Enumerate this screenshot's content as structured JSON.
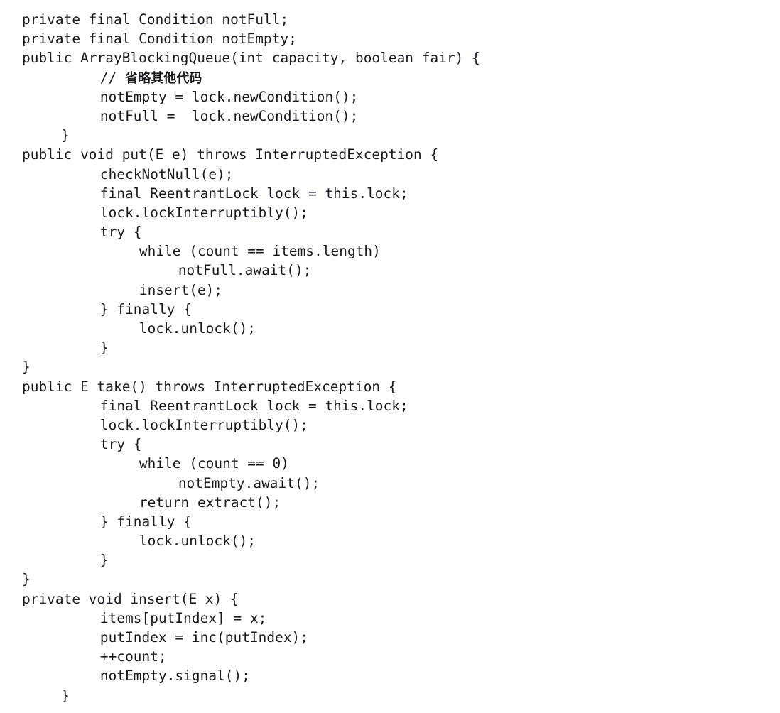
{
  "document": {
    "kind": "source-code-listing",
    "language": "Java",
    "background_color": "#ffffff",
    "text_color": "#1b1b1f",
    "lines": [
      {
        "n": 1,
        "indent": 0,
        "text": "private final Condition notFull;"
      },
      {
        "n": 2,
        "indent": 0,
        "text": "private final Condition notEmpty;"
      },
      {
        "n": 3,
        "indent": 0,
        "text": "public ArrayBlockingQueue(int capacity, boolean fair) {"
      },
      {
        "n": 4,
        "indent": 8,
        "text": "// 省略其他代码",
        "cjk": true,
        "mono_prefix": "// "
      },
      {
        "n": 5,
        "indent": 8,
        "text": "notEmpty = lock.newCondition();"
      },
      {
        "n": 6,
        "indent": 8,
        "text": "notFull =  lock.newCondition();"
      },
      {
        "n": 7,
        "indent": 4,
        "text": "}"
      },
      {
        "n": 8,
        "indent": 0,
        "text": "public void put(E e) throws InterruptedException {"
      },
      {
        "n": 9,
        "indent": 8,
        "text": "checkNotNull(e);"
      },
      {
        "n": 10,
        "indent": 8,
        "text": "final ReentrantLock lock = this.lock;"
      },
      {
        "n": 11,
        "indent": 8,
        "text": "lock.lockInterruptibly();"
      },
      {
        "n": 12,
        "indent": 8,
        "text": "try {"
      },
      {
        "n": 13,
        "indent": 12,
        "text": "while (count == items.length)"
      },
      {
        "n": 14,
        "indent": 16,
        "text": "notFull.await();"
      },
      {
        "n": 15,
        "indent": 12,
        "text": "insert(e);"
      },
      {
        "n": 16,
        "indent": 8,
        "text": "} finally {"
      },
      {
        "n": 17,
        "indent": 12,
        "text": "lock.unlock();"
      },
      {
        "n": 18,
        "indent": 8,
        "text": "}"
      },
      {
        "n": 19,
        "indent": 0,
        "text": "}"
      },
      {
        "n": 20,
        "indent": 0,
        "text": "public E take() throws InterruptedException {"
      },
      {
        "n": 21,
        "indent": 8,
        "text": "final ReentrantLock lock = this.lock;"
      },
      {
        "n": 22,
        "indent": 8,
        "text": "lock.lockInterruptibly();"
      },
      {
        "n": 23,
        "indent": 8,
        "text": "try {"
      },
      {
        "n": 24,
        "indent": 12,
        "text": "while (count == 0)"
      },
      {
        "n": 25,
        "indent": 16,
        "text": "notEmpty.await();"
      },
      {
        "n": 26,
        "indent": 12,
        "text": "return extract();"
      },
      {
        "n": 27,
        "indent": 8,
        "text": "} finally {"
      },
      {
        "n": 28,
        "indent": 12,
        "text": "lock.unlock();"
      },
      {
        "n": 29,
        "indent": 8,
        "text": "}"
      },
      {
        "n": 30,
        "indent": 0,
        "text": "}"
      },
      {
        "n": 31,
        "indent": 0,
        "text": "private void insert(E x) {"
      },
      {
        "n": 32,
        "indent": 8,
        "text": "items[putIndex] = x;"
      },
      {
        "n": 33,
        "indent": 8,
        "text": "putIndex = inc(putIndex);"
      },
      {
        "n": 34,
        "indent": 8,
        "text": "++count;"
      },
      {
        "n": 35,
        "indent": 8,
        "text": "notEmpty.signal();"
      },
      {
        "n": 36,
        "indent": 4,
        "text": "}"
      }
    ]
  }
}
